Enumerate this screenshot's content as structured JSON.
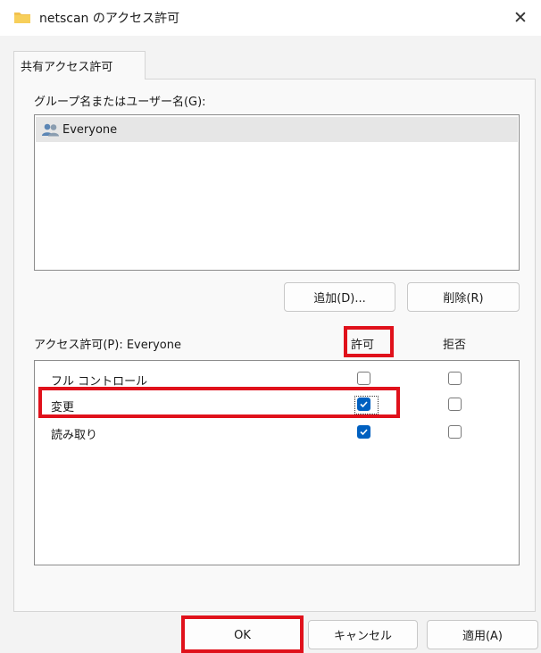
{
  "window": {
    "title": "netscan のアクセス許可",
    "close_glyph": "✕"
  },
  "tab": {
    "label": "共有アクセス許可"
  },
  "group_section": {
    "label": "グループ名またはユーザー名(G):",
    "items": [
      {
        "name": "Everyone",
        "icon": "users-icon",
        "selected": true
      }
    ]
  },
  "buttons": {
    "add": "追加(D)...",
    "remove": "削除(R)",
    "ok": "OK",
    "cancel": "キャンセル",
    "apply": "適用(A)"
  },
  "permissions": {
    "label": "アクセス許可(P): Everyone",
    "allow_header": "許可",
    "deny_header": "拒否",
    "rows": [
      {
        "name": "フル コントロール",
        "allow": false,
        "deny": false
      },
      {
        "name": "変更",
        "allow": true,
        "deny": false
      },
      {
        "name": "読み取り",
        "allow": true,
        "deny": false
      }
    ]
  },
  "colors": {
    "accent": "#0060c0",
    "highlight": "#e0111b",
    "folder": "#f2c14e"
  }
}
